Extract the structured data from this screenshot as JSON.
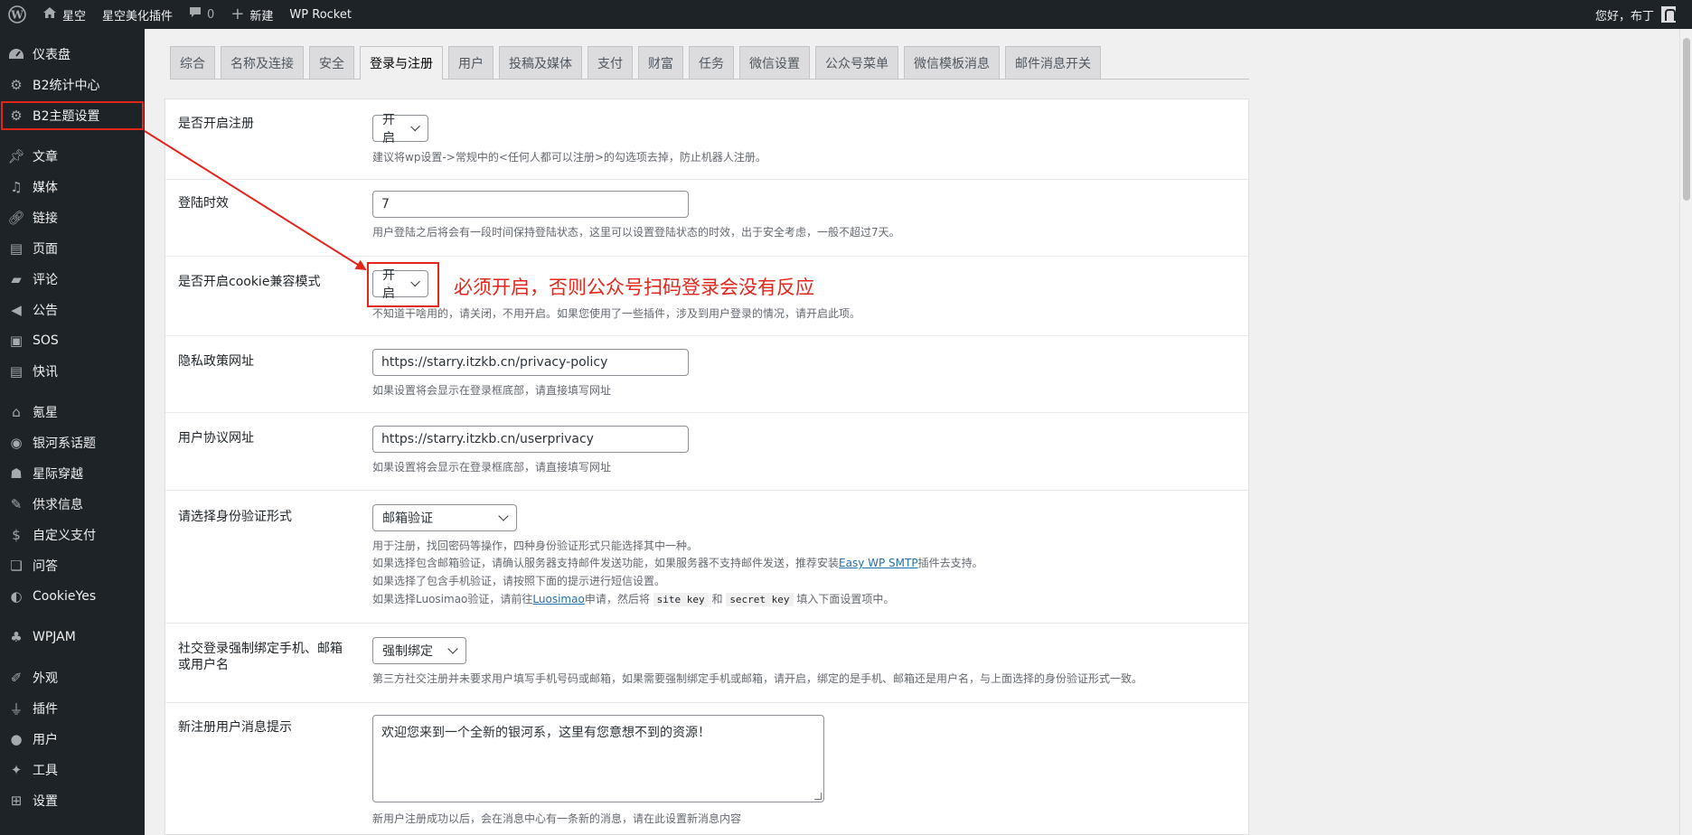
{
  "adminbar": {
    "site_name": "星空",
    "plugin_link": "星空美化插件",
    "comments_count": "0",
    "new_label": "新建",
    "rocket_label": "WP Rocket",
    "greeting": "您好，布丁"
  },
  "sidebar": {
    "items": [
      {
        "label": "仪表盘",
        "icon": "dashboard-icon"
      },
      {
        "label": "B2统计中心",
        "icon": "gear-icon"
      },
      {
        "label": "B2主题设置",
        "icon": "gear-icon"
      },
      {
        "label": "文章",
        "icon": "pin-icon"
      },
      {
        "label": "媒体",
        "icon": "media-icon"
      },
      {
        "label": "链接",
        "icon": "link-icon"
      },
      {
        "label": "页面",
        "icon": "page-icon"
      },
      {
        "label": "评论",
        "icon": "comment-icon"
      },
      {
        "label": "公告",
        "icon": "megaphone-icon"
      },
      {
        "label": "SOS",
        "icon": "sos-icon"
      },
      {
        "label": "快讯",
        "icon": "news-icon"
      },
      {
        "label": "氪星",
        "icon": "bell-icon"
      },
      {
        "label": "银河系话题",
        "icon": "topic-icon"
      },
      {
        "label": "星际穿越",
        "icon": "group-icon"
      },
      {
        "label": "供求信息",
        "icon": "edit-icon"
      },
      {
        "label": "自定义支付",
        "icon": "dollar-icon"
      },
      {
        "label": "问答",
        "icon": "qa-icon"
      },
      {
        "label": "CookieYes",
        "icon": "cookie-icon"
      },
      {
        "label": "WPJAM",
        "icon": "wpjam-icon"
      },
      {
        "label": "外观",
        "icon": "brush-icon"
      },
      {
        "label": "插件",
        "icon": "plugin-icon"
      },
      {
        "label": "用户",
        "icon": "user-icon"
      },
      {
        "label": "工具",
        "icon": "wrench-icon"
      },
      {
        "label": "设置",
        "icon": "settings-icon"
      }
    ]
  },
  "tabs": [
    "综合",
    "名称及连接",
    "安全",
    "登录与注册",
    "用户",
    "投稿及媒体",
    "支付",
    "财富",
    "任务",
    "微信设置",
    "公众号菜单",
    "微信模板消息",
    "邮件消息开关"
  ],
  "active_tab": "登录与注册",
  "form": {
    "register": {
      "label": "是否开启注册",
      "value": "开启",
      "desc": "建议将wp设置->常规中的<任何人都可以注册>的勾选项去掉，防止机器人注册。"
    },
    "login_expire": {
      "label": "登陆时效",
      "value": "7",
      "desc": "用户登陆之后将会有一段时间保持登陆状态，这里可以设置登陆状态的时效，出于安全考虑，一般不超过7天。"
    },
    "cookie_compat": {
      "label": "是否开启cookie兼容模式",
      "value": "开启",
      "desc": "不知道干啥用的，请关闭，不用开启。如果您使用了一些插件，涉及到用户登录的情况，请开启此项。"
    },
    "privacy_url": {
      "label": "隐私政策网址",
      "value": "https://starry.itzkb.cn/privacy-policy",
      "desc": "如果设置将会显示在登录框底部，请直接填写网址"
    },
    "agreement_url": {
      "label": "用户协议网址",
      "value": "https://starry.itzkb.cn/userprivacy",
      "desc": "如果设置将会显示在登录框底部，请直接填写网址"
    },
    "verify_type": {
      "label": "请选择身份验证形式",
      "value": "邮箱验证",
      "desc1": "用于注册，找回密码等操作，四种身份验证形式只能选择其中一种。",
      "desc2_pre": "如果选择包含邮箱验证，请确认服务器支持邮件发送功能，如果服务器不支持邮件发送，推荐安装",
      "desc2_link": "Easy WP SMTP",
      "desc2_post": "插件去支持。",
      "desc3": "如果选择了包含手机验证，请按照下面的提示进行短信设置。",
      "desc4_pre": "如果选择Luosimao验证，请前往",
      "desc4_link": "Luosimao",
      "desc4_mid": "申请，然后将",
      "code1": "site key",
      "desc4_and": "和",
      "code2": "secret key",
      "desc4_post": "填入下面设置项中。"
    },
    "social_bind": {
      "label": "社交登录强制绑定手机、邮箱或用户名",
      "value": "强制绑定",
      "desc": "第三方社交注册并未要求用户填写手机号码或邮箱，如果需要强制绑定手机或邮箱，请开启，绑定的是手机、邮箱还是用户名，与上面选择的身份验证形式一致。"
    },
    "welcome_msg": {
      "label": "新注册用户消息提示",
      "value": "欢迎您来到一个全新的银河系，这里有您意想不到的资源！",
      "desc": "新用户注册成功以后，会在消息中心有一条新的消息，请在此设置新消息内容"
    }
  },
  "annotation": {
    "text": "必须开启，否则公众号扫码登录会没有反应",
    "color": "#e2261c"
  },
  "colors": {
    "adminbar_bg": "#1d2327",
    "link": "#2271b1"
  }
}
